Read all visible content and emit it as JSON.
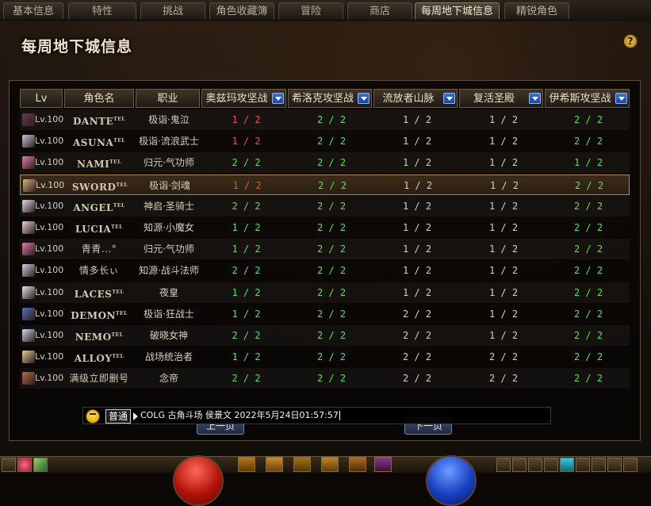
{
  "tabs": [
    {
      "label": "基本信息",
      "active": false
    },
    {
      "label": "特性",
      "active": false
    },
    {
      "label": "挑战",
      "active": false
    },
    {
      "label": "角色收藏簿",
      "active": false
    },
    {
      "label": "冒险",
      "active": false
    },
    {
      "label": "商店",
      "active": false
    },
    {
      "label": "每周地下城信息",
      "active": true
    },
    {
      "label": "精锐角色",
      "active": false
    }
  ],
  "page": {
    "title": "每周地下城信息",
    "help_label": "?"
  },
  "table": {
    "headers": {
      "lv": "Lv",
      "name": "角色名",
      "job": "职业",
      "d0": "奥兹玛攻坚战",
      "d1": "希洛克攻坚战",
      "d2": "流放者山脉",
      "d3": "复活圣殿",
      "d4": "伊希斯攻坚战"
    },
    "rows": [
      {
        "lv": "Lv.100",
        "name": "DANTE",
        "tel": "TEL",
        "job": "极诣·鬼泣",
        "d": [
          "1 / 2",
          "2 / 2",
          "1 / 2",
          "1 / 2",
          "2 / 2"
        ],
        "c": [
          "r",
          "g",
          "w",
          "w",
          "g"
        ],
        "avatar": "#6a3b4a"
      },
      {
        "lv": "Lv.100",
        "name": "ASUNA",
        "tel": "TEL",
        "job": "极诣·流浪武士",
        "d": [
          "1 / 2",
          "2 / 2",
          "1 / 2",
          "1 / 2",
          "2 / 2"
        ],
        "c": [
          "r",
          "g",
          "w",
          "w",
          "g"
        ],
        "avatar": "#c9c2d6"
      },
      {
        "lv": "Lv.100",
        "name": "NAMI",
        "tel": "TEL",
        "job": "归元·气功师",
        "d": [
          "2 / 2",
          "2 / 2",
          "1 / 2",
          "1 / 2",
          "1 / 2"
        ],
        "c": [
          "g",
          "g",
          "w",
          "w",
          "g"
        ],
        "avatar": "#e07aa6"
      },
      {
        "lv": "Lv.100",
        "name": "SWORD",
        "tel": "TEL",
        "job": "极诣·剑魂",
        "d": [
          "1 / 2",
          "2 / 2",
          "1 / 2",
          "1 / 2",
          "2 / 2"
        ],
        "c": [
          "r",
          "g",
          "w",
          "w",
          "g"
        ],
        "avatar": "#d9b07a"
      },
      {
        "lv": "Lv.100",
        "name": "ANGEL",
        "tel": "TEL",
        "job": "神启·圣骑士",
        "d": [
          "2 / 2",
          "2 / 2",
          "1 / 2",
          "1 / 2",
          "2 / 2"
        ],
        "c": [
          "g",
          "g",
          "w",
          "w",
          "g"
        ],
        "avatar": "#e6d8e8"
      },
      {
        "lv": "Lv.100",
        "name": "LUCIA",
        "tel": "TEL",
        "job": "知源·小魔女",
        "d": [
          "1 / 2",
          "2 / 2",
          "1 / 2",
          "1 / 2",
          "2 / 2"
        ],
        "c": [
          "g",
          "g",
          "w",
          "w",
          "g"
        ],
        "avatar": "#e5d4da"
      },
      {
        "lv": "Lv.100",
        "name": "青青...°",
        "tel": "",
        "job": "归元·气功师",
        "d": [
          "1 / 2",
          "2 / 2",
          "1 / 2",
          "1 / 2",
          "2 / 2"
        ],
        "c": [
          "g",
          "g",
          "w",
          "w",
          "g"
        ],
        "avatar": "#e07aa6"
      },
      {
        "lv": "Lv.100",
        "name": "情多长ぃ",
        "tel": "",
        "job": "知源·战斗法师",
        "d": [
          "2 / 2",
          "2 / 2",
          "1 / 2",
          "1 / 2",
          "2 / 2"
        ],
        "c": [
          "g",
          "g",
          "w",
          "w",
          "g"
        ],
        "avatar": "#d4cce0"
      },
      {
        "lv": "Lv.100",
        "name": "LACES",
        "tel": "TEL",
        "job": "夜皇",
        "d": [
          "1 / 2",
          "2 / 2",
          "1 / 2",
          "1 / 2",
          "2 / 2"
        ],
        "c": [
          "g",
          "g",
          "w",
          "w",
          "g"
        ],
        "avatar": "#e8e2ec"
      },
      {
        "lv": "Lv.100",
        "name": "DEMON",
        "tel": "TEL",
        "job": "极诣·狂战士",
        "d": [
          "1 / 2",
          "2 / 2",
          "2 / 2",
          "1 / 2",
          "2 / 2"
        ],
        "c": [
          "g",
          "g",
          "w",
          "w",
          "g"
        ],
        "avatar": "#5d6fb8"
      },
      {
        "lv": "Lv.100",
        "name": "NEMO",
        "tel": "TEL",
        "job": "破晓女神",
        "d": [
          "2 / 2",
          "2 / 2",
          "2 / 2",
          "1 / 2",
          "2 / 2"
        ],
        "c": [
          "g",
          "g",
          "w",
          "w",
          "g"
        ],
        "avatar": "#cfd9ee"
      },
      {
        "lv": "Lv.100",
        "name": "ALLOY",
        "tel": "TEL",
        "job": "战场统治者",
        "d": [
          "1 / 2",
          "2 / 2",
          "2 / 2",
          "2 / 2",
          "2 / 2"
        ],
        "c": [
          "g",
          "g",
          "w",
          "w",
          "g"
        ],
        "avatar": "#e4c98a"
      },
      {
        "lv": "Lv.100",
        "name": "满级立即删号",
        "tel": "",
        "job": "念帝",
        "d": [
          "2 / 2",
          "2 / 2",
          "2 / 2",
          "2 / 2",
          "2 / 2"
        ],
        "c": [
          "g",
          "g",
          "w",
          "w",
          "g"
        ],
        "avatar": "#b5694a"
      }
    ],
    "selected_row": 3
  },
  "pager": {
    "prev": "上一页",
    "next": "下一页"
  },
  "chat": {
    "channel": "普通",
    "message": "COLG 古角斗场 侯景文 2022年5月24日01:57:57"
  },
  "colors": {
    "green": "#5ee04f",
    "red": "#ff4a3d",
    "white": "#d6d0c2",
    "dropdown": "#2b56c4",
    "selected_border": "#b0894b"
  }
}
